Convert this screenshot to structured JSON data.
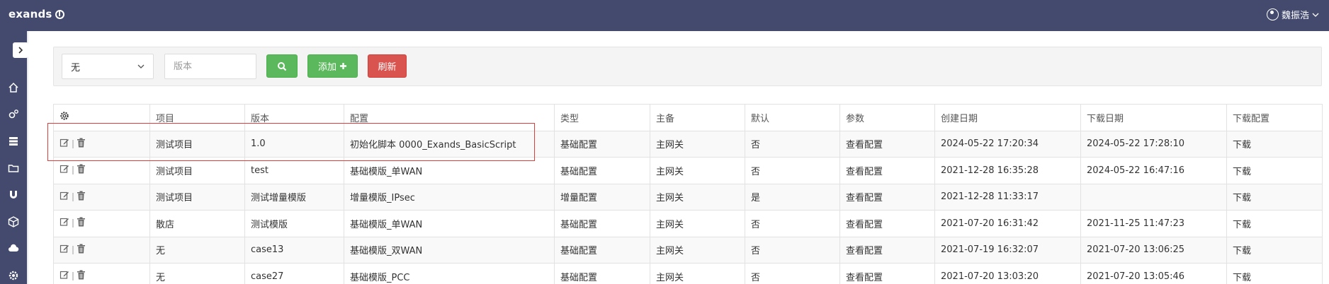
{
  "app": {
    "logo_text": "exands",
    "user_name": "魏振浩"
  },
  "toolbar": {
    "select_value": "无",
    "version_placeholder": "版本",
    "add_label": "添加",
    "refresh_label": "刷新"
  },
  "table": {
    "columns": [
      "项目",
      "版本",
      "配置",
      "类型",
      "主备",
      "默认",
      "参数",
      "创建日期",
      "下载日期",
      "下载配置"
    ],
    "rows": [
      {
        "project": "测试项目",
        "version": "1.0",
        "config": "初始化脚本 0000_Exands_BasicScript",
        "type": "基础配置",
        "role": "主网关",
        "default": "否",
        "params": "查看配置",
        "created": "2024-05-22 17:20:34",
        "downloaded": "2024-05-22 17:28:10",
        "download": "下载"
      },
      {
        "project": "测试项目",
        "version": "test",
        "config": "基础模版_单WAN",
        "type": "基础配置",
        "role": "主网关",
        "default": "否",
        "params": "查看配置",
        "created": "2021-12-28 16:35:28",
        "downloaded": "2024-05-22 16:47:16",
        "download": "下载"
      },
      {
        "project": "测试项目",
        "version": "测试增量模版",
        "config": "增量模版_IPsec",
        "type": "增量配置",
        "role": "主网关",
        "default": "是",
        "params": "查看配置",
        "created": "2021-12-28 11:33:17",
        "downloaded": "",
        "download": "下载"
      },
      {
        "project": "散店",
        "version": "测试模版",
        "config": "基础模版_单WAN",
        "type": "基础配置",
        "role": "主网关",
        "default": "否",
        "params": "查看配置",
        "created": "2021-07-20 16:31:42",
        "downloaded": "2021-11-25 11:47:23",
        "download": "下载"
      },
      {
        "project": "无",
        "version": "case13",
        "config": "基础模版_双WAN",
        "type": "基础配置",
        "role": "主网关",
        "default": "否",
        "params": "查看配置",
        "created": "2021-07-19 16:32:07",
        "downloaded": "2021-07-20 13:06:25",
        "download": "下载"
      },
      {
        "project": "无",
        "version": "case27",
        "config": "基础模版_PCC",
        "type": "基础配置",
        "role": "主网关",
        "default": "否",
        "params": "查看配置",
        "created": "2021-07-20 13:03:20",
        "downloaded": "2021-07-20 13:05:46",
        "download": "下载"
      }
    ]
  },
  "colors": {
    "topbar": "#434a6e",
    "success": "#5cb85c",
    "danger": "#d9534f",
    "highlight": "#e03c3c"
  },
  "icons": {
    "sidebar": [
      "home-icon",
      "gears-icon",
      "server-icon",
      "folder-icon",
      "magnet-icon",
      "cube-icon",
      "cloud-icon",
      "settings-icon"
    ],
    "row_actions": [
      "edit-icon",
      "trash-icon"
    ]
  }
}
